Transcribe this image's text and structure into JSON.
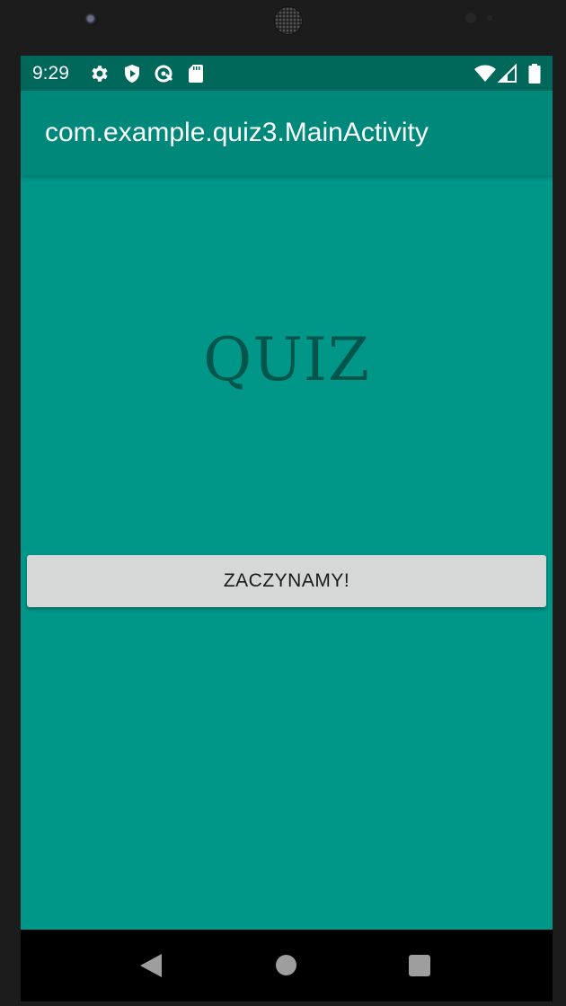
{
  "status_bar": {
    "time": "9:29",
    "left_icons": [
      "settings-gear-icon",
      "shield-play-icon",
      "data-saver-icon",
      "sd-card-icon"
    ],
    "right_icons": [
      "wifi-icon",
      "cell-signal-icon",
      "battery-icon"
    ]
  },
  "app_bar": {
    "title": "com.example.quiz3.MainActivity"
  },
  "main": {
    "heading": "QUIZ",
    "start_button_label": "ZACZYNAMY!"
  },
  "navigation_bar": {
    "buttons": [
      "back-icon",
      "home-icon",
      "recents-icon"
    ]
  },
  "colors": {
    "status_bar": "#00675b",
    "app_bar": "#00897b",
    "background": "#009688",
    "heading_text": "#00564c",
    "button": "#d6d7d7"
  }
}
